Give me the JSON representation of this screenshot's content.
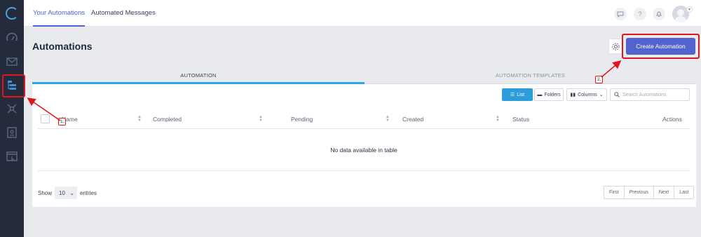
{
  "colors": {
    "accent": "#4f63d2",
    "create_button": "#5163cc",
    "active_subtab": "#2ba5e8",
    "sidebar_bg": "#232b3c",
    "annotation": "#e0161b"
  },
  "sidebar": {
    "items": [
      {
        "icon": "logo-icon"
      },
      {
        "icon": "speedometer-icon"
      },
      {
        "icon": "mail-icon"
      },
      {
        "icon": "automation-flow-icon",
        "active": true
      },
      {
        "icon": "network-icon"
      },
      {
        "icon": "form-document-icon"
      },
      {
        "icon": "browser-window-icon"
      }
    ]
  },
  "topbar": {
    "tabs": [
      {
        "label": "Your Automations",
        "active": true
      },
      {
        "label": "Automated Messages"
      }
    ],
    "icons": [
      "chat-icon",
      "help-icon",
      "bell-icon",
      "avatar"
    ],
    "help_glyph": "?"
  },
  "page": {
    "title": "Automations",
    "create_button": "Create Automation"
  },
  "subtabs": [
    {
      "label": "AUTOMATION",
      "active": true
    },
    {
      "label": "AUTOMATION TEMPLATES"
    }
  ],
  "toolbar": {
    "list_label": "List",
    "folders_label": "Folders",
    "columns_label": "Columns",
    "search_placeholder": "Search Automations"
  },
  "table": {
    "columns": [
      "Name",
      "Completed",
      "Pending",
      "Created",
      "Status",
      "Actions"
    ],
    "empty_message": "No data available in table"
  },
  "footer": {
    "show_label": "Show",
    "page_size": "10",
    "entries_label": "entries",
    "pager": [
      "First",
      "Previous",
      "Next",
      "Last"
    ]
  },
  "annotations": {
    "step1": "1.",
    "step2": "2."
  }
}
